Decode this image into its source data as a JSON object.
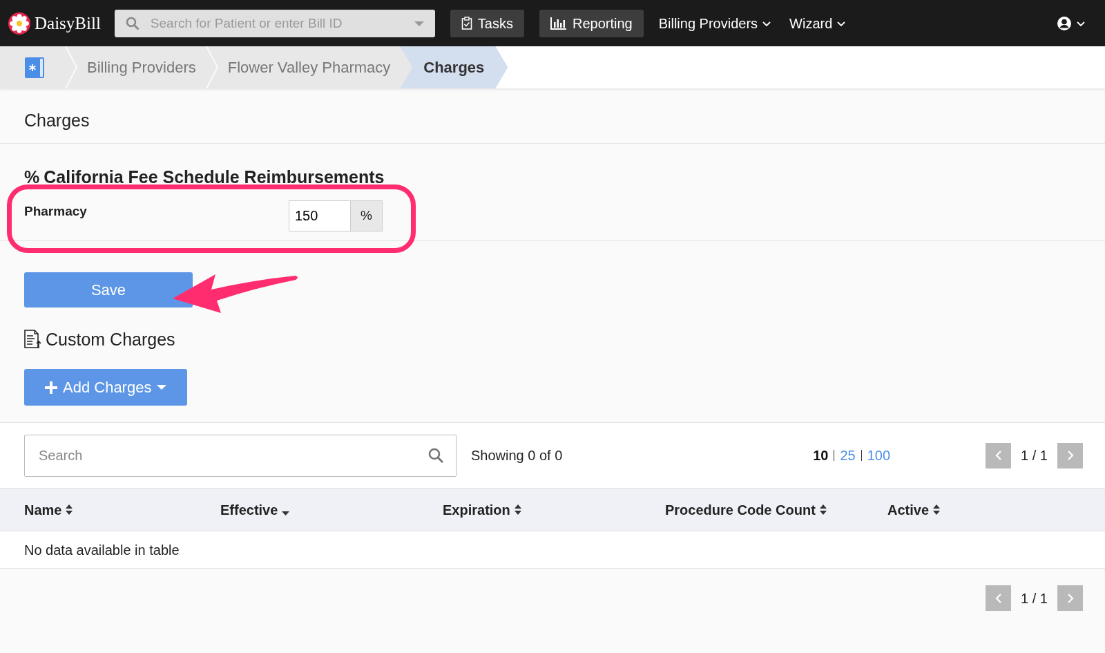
{
  "navbar": {
    "logo": "DaisyBill",
    "search": {
      "placeholder": "Search for Patient or enter Bill ID"
    },
    "items": [
      {
        "label": "Tasks",
        "kind": "button"
      },
      {
        "label": "Reporting",
        "kind": "button"
      },
      {
        "label": "Billing Providers",
        "kind": "dropdown"
      },
      {
        "label": "Wizard",
        "kind": "dropdown"
      }
    ]
  },
  "breadcrumb": [
    {
      "label": "Billing Providers",
      "selected": false
    },
    {
      "label": "Flower Valley Pharmacy",
      "selected": false
    },
    {
      "label": "Charges",
      "selected": true
    }
  ],
  "page_title": "Charges",
  "fee_schedule": {
    "icon": "%",
    "title": "California Fee Schedule Reimbursements",
    "fields": [
      {
        "label": "Pharmacy",
        "value": "150",
        "unit": "%"
      }
    ]
  },
  "save_button": "Save",
  "custom_charges": {
    "title": "Custom Charges",
    "add_button": "Add Charges"
  },
  "table": {
    "search_placeholder": "Search",
    "info": "Showing 0 of 0",
    "page_sizes": [
      {
        "label": "10",
        "selected": true
      },
      {
        "label": "25",
        "selected": false
      },
      {
        "label": "100",
        "selected": false
      }
    ],
    "pagination": "1 / 1",
    "columns": [
      {
        "label": "Name",
        "sorted": false
      },
      {
        "label": "Effective",
        "sorted": true
      },
      {
        "label": "Expiration",
        "sorted": false
      },
      {
        "label": "Procedure Code Count",
        "sorted": false
      },
      {
        "label": "Active",
        "sorted": false
      }
    ],
    "empty_message": "No data available in table",
    "bottom_pagination": "1 / 1"
  }
}
